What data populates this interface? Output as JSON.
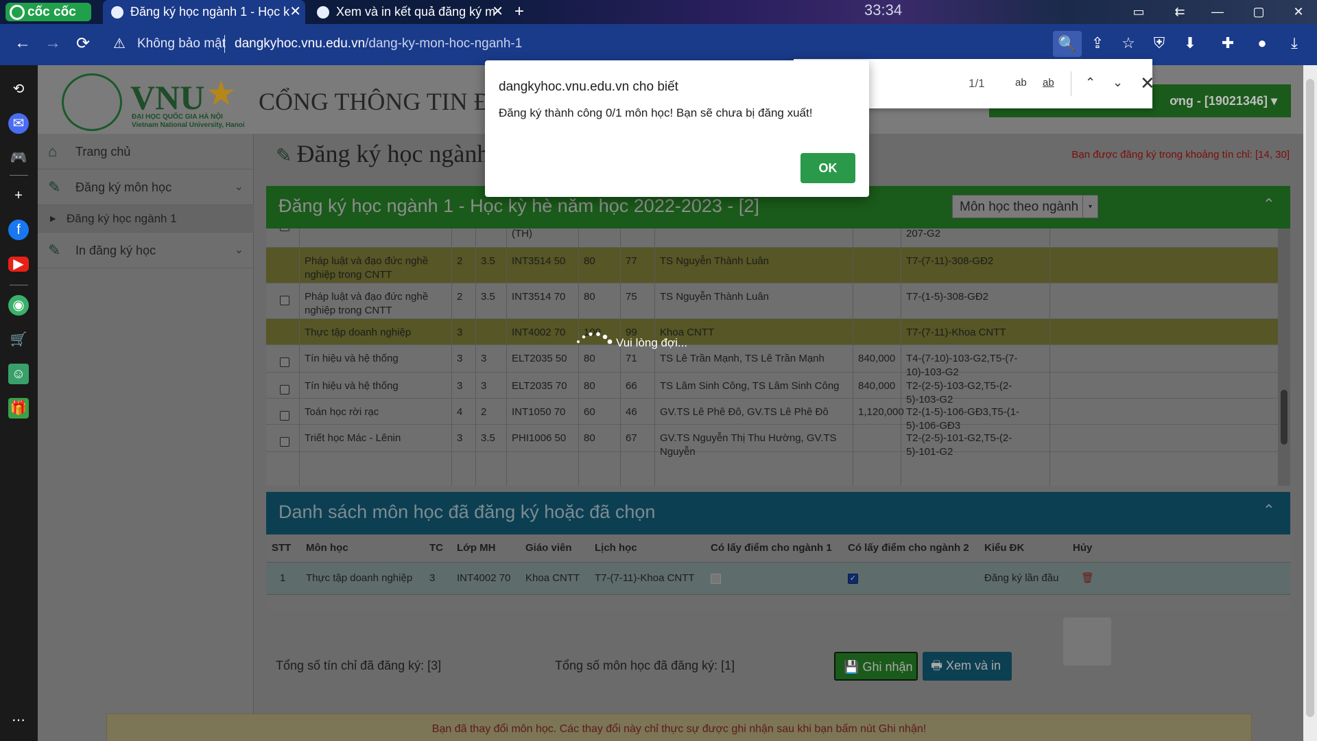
{
  "browser": {
    "brand": "cốc cốc",
    "tabs": [
      {
        "title": "Đăng ký học ngành 1 - Học k"
      },
      {
        "title": "Xem và in kết quả đăng ký m"
      }
    ],
    "clock": "33:34",
    "not_secure": "Không bảo mật",
    "url_host": "dangkyhoc.vnu.edu.vn",
    "url_path": "/dang-ky-mon-hoc-nganh-1"
  },
  "header": {
    "logo_text": "VNU",
    "logo_sub1": "ĐẠI HỌC QUỐC GIA HÀ NỘI",
    "logo_sub2": "Vietnam National University, Hanoi",
    "portal": "CỔNG THÔNG TIN Đ",
    "user": "ơng - [19021346] ▾"
  },
  "menu": {
    "home": "Trang chủ",
    "register": "Đăng ký môn học",
    "register_sub": "Đăng ký học ngành 1",
    "print": "In đăng ký học"
  },
  "main": {
    "title": "Đăng ký học ngành",
    "credit_range": "Bạn được đăng ký trong khoảng tín chỉ: [14, 30]",
    "panel1_title": "Đăng ký học ngành 1 - Học kỳ hè năm học 2022-2023 - [2]",
    "filter": "Môn học theo ngành",
    "loading": "Vui lòng đợi...",
    "courses": [
      {
        "name": "",
        "tc": "",
        "h": "",
        "code": "(TH)",
        "max": "",
        "reg": "",
        "teacher": "",
        "fee": "",
        "schedule": "207-G2",
        "hl": false,
        "cb": true
      },
      {
        "name": "Pháp luật và đạo đức nghề nghiệp trong CNTT",
        "tc": "2",
        "h": "3.5",
        "code": "INT3514 50",
        "max": "80",
        "reg": "77",
        "teacher": "TS Nguyễn Thành Luân",
        "fee": "",
        "schedule": "T7-(7-11)-308-GĐ2",
        "hl": true,
        "cb": false
      },
      {
        "name": "Pháp luật và đạo đức nghề nghiệp trong CNTT",
        "tc": "2",
        "h": "3.5",
        "code": "INT3514 70",
        "max": "80",
        "reg": "75",
        "teacher": "TS Nguyễn Thành Luân",
        "fee": "",
        "schedule": "T7-(1-5)-308-GĐ2",
        "hl": false,
        "cb": true
      },
      {
        "name": "Thực tập doanh nghiệp",
        "tc": "3",
        "h": "",
        "code": "INT4002 70",
        "max": "100",
        "reg": "99",
        "teacher": "Khoa CNTT",
        "fee": "",
        "schedule": "T7-(7-11)-Khoa CNTT",
        "hl": true,
        "cb": false
      },
      {
        "name": "Tín hiệu và hệ thống",
        "tc": "3",
        "h": "3",
        "code": "ELT2035 50",
        "max": "80",
        "reg": "71",
        "teacher": "TS Lê Trần Mạnh, TS Lê Trần Mạnh",
        "fee": "840,000",
        "schedule": "T4-(7-10)-103-G2,T5-(7-10)-103-G2",
        "hl": false,
        "cb": true
      },
      {
        "name": "Tín hiệu và hệ thống",
        "tc": "3",
        "h": "3",
        "code": "ELT2035 70",
        "max": "80",
        "reg": "66",
        "teacher": "TS Lâm Sinh Công, TS Lâm Sinh Công",
        "fee": "840,000",
        "schedule": "T2-(2-5)-103-G2,T5-(2-5)-103-G2",
        "hl": false,
        "cb": true
      },
      {
        "name": "Toán học rời rạc",
        "tc": "4",
        "h": "2",
        "code": "INT1050 70",
        "max": "60",
        "reg": "46",
        "teacher": "GV.TS Lê Phê Đô, GV.TS Lê Phê Đô",
        "fee": "1,120,000",
        "schedule": "T2-(1-5)-106-GĐ3,T5-(1-5)-106-GĐ3",
        "hl": false,
        "cb": true
      },
      {
        "name": "Triết học Mác - Lênin",
        "tc": "3",
        "h": "3.5",
        "code": "PHI1006 50",
        "max": "80",
        "reg": "67",
        "teacher": "GV.TS Nguyễn Thị Thu Hường, GV.TS Nguyễn",
        "fee": "",
        "schedule": "T2-(2-5)-101-G2,T5-(2-5)-101-G2",
        "hl": false,
        "cb": true
      }
    ],
    "panel2_title": "Danh sách môn học đã đăng ký hoặc đã chọn",
    "reg_headers": [
      "STT",
      "Môn học",
      "TC",
      "Lớp MH",
      "Giáo viên",
      "Lịch học",
      "Có lấy điểm cho ngành 1",
      "Có lấy điểm cho ngành 2",
      "Kiểu ĐK",
      "Hủy"
    ],
    "reg_row": {
      "stt": "1",
      "name": "Thực tập doanh nghiệp",
      "tc": "3",
      "code": "INT4002 70",
      "teacher": "Khoa CNTT",
      "schedule": "T7-(7-11)-Khoa CNTT",
      "type": "Đăng ký lần đầu",
      "n1_checked": false,
      "n2_checked": true
    },
    "total_credits": "Tổng số tín chỉ đã đăng ký: [3]",
    "total_courses": "Tổng số môn học đã đăng ký: [1]",
    "btn_save": "Ghi nhận",
    "btn_print": "Xem và in",
    "notice": "Bạn đã thay đổi môn học. Các thay đổi này chỉ thực sự được ghi nhận sau khi bạn bấm nút Ghi nhận!"
  },
  "findbar": {
    "count": "1/1",
    "opt1": "ab",
    "opt2": "ab"
  },
  "dialog": {
    "title": "dangkyhoc.vnu.edu.vn cho biết",
    "message": "Đăng ký thành công 0/1 môn học! Bạn sẽ chưa bị đăng xuất!",
    "ok": "OK"
  }
}
